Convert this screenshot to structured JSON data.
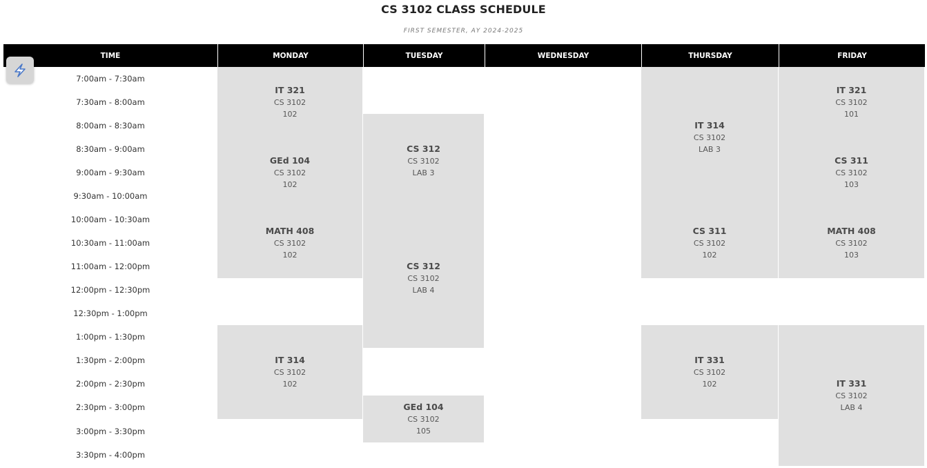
{
  "title": "CS 3102 CLASS SCHEDULE",
  "subtitle": "FIRST SEMESTER, AY 2024-2025",
  "headers": {
    "time": "TIME",
    "monday": "MONDAY",
    "tuesday": "TUESDAY",
    "wednesday": "WEDNESDAY",
    "thursday": "THURSDAY",
    "friday": "FRIDAY"
  },
  "times": [
    "7:00am - 7:30am",
    "7:30am - 8:00am",
    "8:00am - 8:30am",
    "8:30am - 9:00am",
    "9:00am - 9:30am",
    "9:30am - 10:00am",
    "10:00am - 10:30am",
    "10:30am - 11:00am",
    "11:00am - 12:00pm",
    "12:00pm - 12:30pm",
    "12:30pm - 1:00pm",
    "1:00pm - 1:30pm",
    "1:30pm - 2:00pm",
    "2:00pm - 2:30pm",
    "2:30pm - 3:00pm",
    "3:00pm - 3:30pm",
    "3:30pm - 4:00pm"
  ],
  "classes": {
    "mon_1": {
      "course": "IT 321",
      "section": "CS 3102",
      "room": "102"
    },
    "mon_2": {
      "course": "GEd 104",
      "section": "CS 3102",
      "room": "102"
    },
    "mon_3": {
      "course": "MATH 408",
      "section": "CS 3102",
      "room": "102"
    },
    "mon_4": {
      "course": "IT 314",
      "section": "CS 3102",
      "room": "102"
    },
    "tue_1": {
      "course": "CS 312",
      "section": "CS 3102",
      "room": "LAB 3"
    },
    "tue_2": {
      "course": "CS 312",
      "section": "CS 3102",
      "room": "LAB 4"
    },
    "tue_3": {
      "course": "GEd 104",
      "section": "CS 3102",
      "room": "105"
    },
    "thu_1": {
      "course": "IT 314",
      "section": "CS 3102",
      "room": "LAB 3"
    },
    "thu_2": {
      "course": "CS 311",
      "section": "CS 3102",
      "room": "102"
    },
    "thu_3": {
      "course": "IT 331",
      "section": "CS 3102",
      "room": "102"
    },
    "fri_1": {
      "course": "IT 321",
      "section": "CS 3102",
      "room": "101"
    },
    "fri_2": {
      "course": "CS 311",
      "section": "CS 3102",
      "room": "103"
    },
    "fri_3": {
      "course": "MATH 408",
      "section": "CS 3102",
      "room": "103"
    },
    "fri_4": {
      "course": "IT 331",
      "section": "CS 3102",
      "room": "LAB 4"
    }
  },
  "colors": {
    "header_bg": "#000000",
    "cell_bg": "#e0e0e0"
  },
  "badge_icon": "lightning-bolt-icon"
}
